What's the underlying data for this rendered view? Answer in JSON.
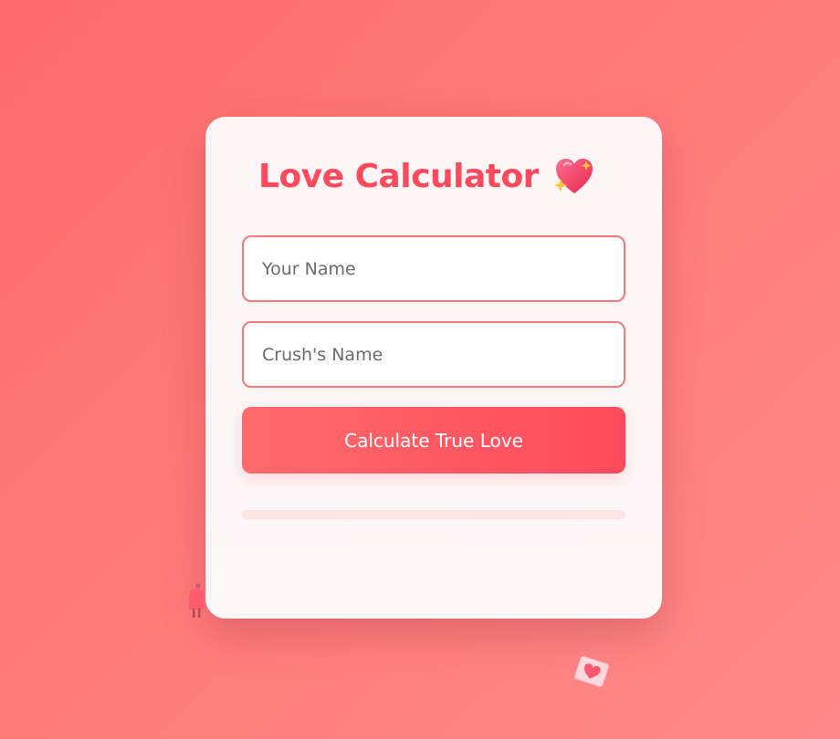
{
  "app": {
    "title": "Love Calculator",
    "title_icon": "sparkling-heart-icon"
  },
  "form": {
    "your_name": {
      "placeholder": "Your Name",
      "value": ""
    },
    "crush_name": {
      "placeholder": "Crush's Name",
      "value": ""
    },
    "submit_label": "Calculate True Love"
  },
  "result": {
    "progress": 0
  },
  "decorations": {
    "left": "couple-figure-icon",
    "right": "love-letter-icon"
  },
  "colors": {
    "background": "#ff7a7a",
    "accent": "#ff4a5e",
    "field_border": "#f27a7a",
    "card": "#fdf6f7"
  }
}
